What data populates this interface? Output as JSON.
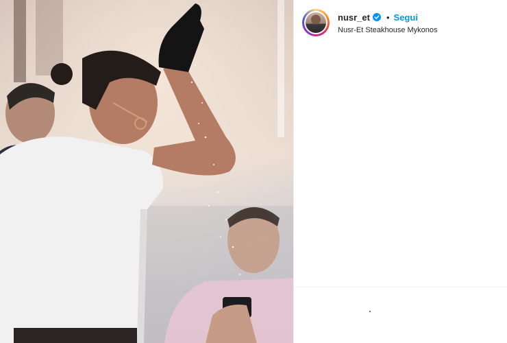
{
  "post": {
    "username": "nusr_et",
    "follow_label": "Segui",
    "separator": "•",
    "location": "Nusr-Et Steakhouse Mykonos"
  },
  "icons": {
    "verified": "verified-badge-icon",
    "avatar": "profile-avatar"
  },
  "colors": {
    "follow_blue": "#0095f6",
    "verified_blue": "#0095f6",
    "text_dark": "#262626"
  }
}
